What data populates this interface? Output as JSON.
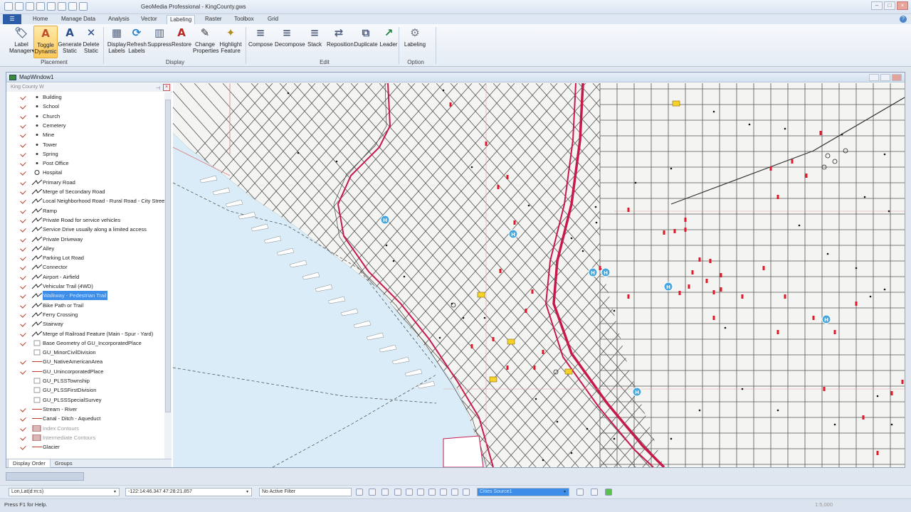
{
  "window": {
    "title": "GeoMedia Professional - KingCounty.gws"
  },
  "menu": {
    "file": "☰",
    "tabs": [
      "Home",
      "Manage Data",
      "Analysis",
      "Vector",
      "Labeling",
      "Raster",
      "Toolbox",
      "Grid"
    ],
    "active_tab": "Labeling"
  },
  "ribbon": {
    "buttons": [
      {
        "l1": "Label",
        "l2": "Manager▾",
        "icon": "label-manager-icon"
      },
      {
        "l1": "Toggle",
        "l2": "Dynamic",
        "icon": "toggle-dynamic-icon",
        "active": true
      },
      {
        "l1": "Generate",
        "l2": "Static",
        "icon": "generate-static-icon"
      },
      {
        "l1": "Delete",
        "l2": "Static",
        "icon": "delete-static-icon"
      },
      {
        "l1": "Display",
        "l2": "Labels",
        "icon": "display-labels-icon"
      },
      {
        "l1": "Refresh",
        "l2": "Labels",
        "icon": "refresh-labels-icon"
      },
      {
        "l1": "Suppress",
        "l2": "",
        "icon": "suppress-icon"
      },
      {
        "l1": "Restore",
        "l2": "",
        "icon": "restore-icon"
      },
      {
        "l1": "Change",
        "l2": "Properties",
        "icon": "change-properties-icon"
      },
      {
        "l1": "Highlight",
        "l2": "Feature",
        "icon": "highlight-feature-icon"
      },
      {
        "l1": "Compose",
        "l2": "",
        "icon": "compose-icon"
      },
      {
        "l1": "Decompose",
        "l2": "",
        "icon": "decompose-icon"
      },
      {
        "l1": "Stack",
        "l2": "",
        "icon": "stack-icon"
      },
      {
        "l1": "Reposition",
        "l2": "",
        "icon": "reposition-icon"
      },
      {
        "l1": "Duplicate",
        "l2": "",
        "icon": "duplicate-icon"
      },
      {
        "l1": "Leader",
        "l2": "",
        "icon": "leader-icon"
      },
      {
        "l1": "Labeling",
        "l2": "",
        "icon": "labeling-options-icon"
      }
    ],
    "groups": [
      "Placement",
      "Display",
      "Edit",
      "Option"
    ]
  },
  "map_window": {
    "title": "MapWindow1"
  },
  "legend": {
    "header": "King County W",
    "items": [
      {
        "label": "Building",
        "sym": "dot",
        "checked": true
      },
      {
        "label": "School",
        "sym": "dot",
        "checked": true
      },
      {
        "label": "Church",
        "sym": "dot",
        "checked": true
      },
      {
        "label": "Cemetery",
        "sym": "dot",
        "checked": true
      },
      {
        "label": "Mine",
        "sym": "dot",
        "checked": true
      },
      {
        "label": "Tower",
        "sym": "dot",
        "checked": true
      },
      {
        "label": "Spring",
        "sym": "dot",
        "checked": true
      },
      {
        "label": "Post Office",
        "sym": "dot",
        "checked": true
      },
      {
        "label": "Hospital",
        "sym": "circle",
        "checked": true
      },
      {
        "label": "Primary Road",
        "sym": "line",
        "checked": true
      },
      {
        "label": "Merge of Secondary Road",
        "sym": "line",
        "checked": true
      },
      {
        "label": "Local Neighborhood Road - Rural Road - City Street",
        "sym": "line",
        "checked": true
      },
      {
        "label": "Ramp",
        "sym": "line",
        "checked": true
      },
      {
        "label": "Private Road for service vehicles",
        "sym": "line",
        "checked": true
      },
      {
        "label": "Service Drive usually along a limited access",
        "sym": "line",
        "checked": true
      },
      {
        "label": "Private Driveway",
        "sym": "line",
        "checked": true
      },
      {
        "label": "Alley",
        "sym": "line",
        "checked": true
      },
      {
        "label": "Parking Lot Road",
        "sym": "line",
        "checked": true
      },
      {
        "label": "Connector",
        "sym": "line",
        "checked": true
      },
      {
        "label": "Airport - Airfield",
        "sym": "line",
        "checked": true
      },
      {
        "label": "Vehicular Trail (4WD)",
        "sym": "line",
        "checked": true
      },
      {
        "label": "Walkway - Pedestrian Trail",
        "sym": "line",
        "checked": true,
        "selected": true
      },
      {
        "label": "Bike Path or Trail",
        "sym": "line",
        "checked": true
      },
      {
        "label": "Ferry Crossing",
        "sym": "line",
        "checked": true
      },
      {
        "label": "Stairway",
        "sym": "line",
        "checked": true
      },
      {
        "label": "Merge of Railroad Feature (Main - Spur - Yard)",
        "sym": "line",
        "checked": true
      },
      {
        "label": "Base Geometry of GU_IncorporatedPlace",
        "sym": "box",
        "checked": true
      },
      {
        "label": "GU_MinorCivilDivision",
        "sym": "box",
        "checked": false
      },
      {
        "label": "GU_NativeAmericanArea",
        "sym": "redline",
        "checked": true
      },
      {
        "label": "GU_UnincorporatedPlace",
        "sym": "redline",
        "checked": true
      },
      {
        "label": "GU_PLSSTownship",
        "sym": "box",
        "checked": false
      },
      {
        "label": "GU_PLSSFirstDivision",
        "sym": "box",
        "checked": false
      },
      {
        "label": "GU_PLSSSpecialSurvey",
        "sym": "box",
        "checked": false
      },
      {
        "label": "Stream - River",
        "sym": "redline",
        "checked": true
      },
      {
        "label": "Canal - Ditch - Aqueduct",
        "sym": "redline",
        "checked": true
      },
      {
        "label": "Index Contours",
        "sym": "pattern",
        "checked": true,
        "dim": true
      },
      {
        "label": "Intermediate Contours",
        "sym": "pattern",
        "checked": true,
        "dim": true
      },
      {
        "label": "Glacier",
        "sym": "redline",
        "checked": true
      }
    ],
    "tabs": [
      "Display Order",
      "Groups"
    ]
  },
  "status": {
    "coord_system": "Lon,Lat(d:m:s)",
    "coords": "-122:14:46.347  47:28:21.857",
    "filter": "No Active Filter",
    "search": "Cities Source1"
  },
  "footer": {
    "help": "Press F1 for Help.",
    "scale": "1:5,000"
  },
  "colors": {
    "accent": "#2b5ea7",
    "road_primary": "#c8194b",
    "water": "#d9ecf7",
    "hospital": "#45a7de"
  }
}
